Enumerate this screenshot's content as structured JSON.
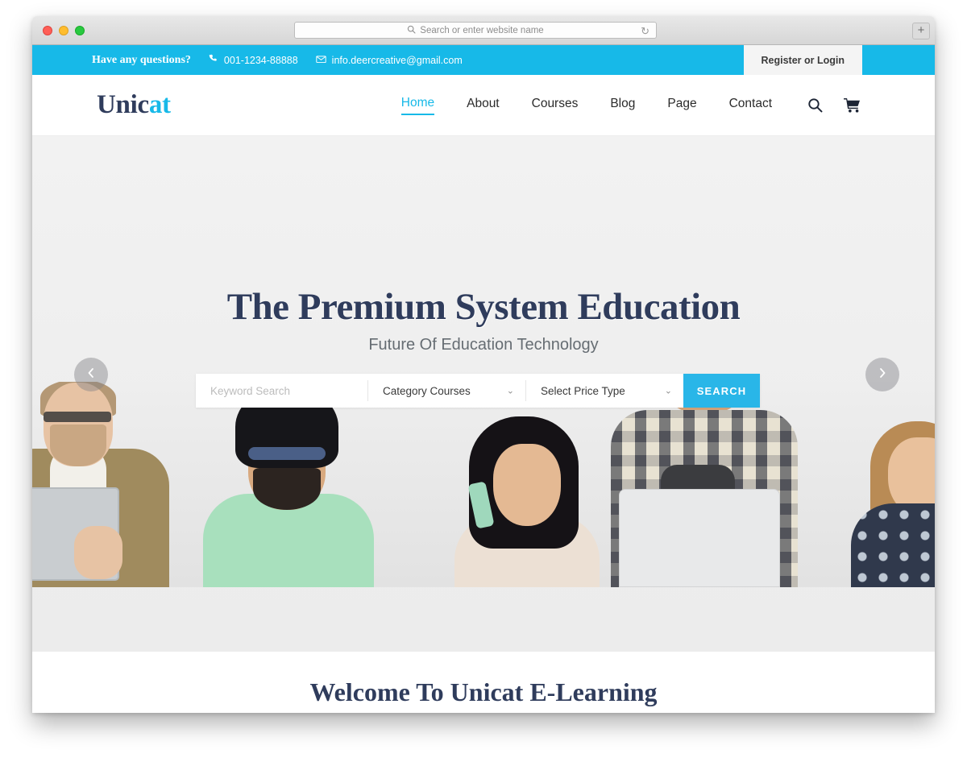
{
  "browser": {
    "url_placeholder": "Search or enter website name",
    "search_icon": "magnifier-icon",
    "reload_icon": "reload-icon",
    "new_tab_label": "+",
    "traffic_lights": [
      "close",
      "minimize",
      "maximize"
    ]
  },
  "topbar": {
    "questions_label": "Have any questions?",
    "phone_icon": "phone-icon",
    "phone": "001-1234-88888",
    "mail_icon": "envelope-icon",
    "email": "info.deercreative@gmail.com",
    "register_login": "Register or Login",
    "bg_color": "#17b9e8"
  },
  "nav": {
    "logo_main": "Unic",
    "logo_accent": "at",
    "links": [
      {
        "label": "Home",
        "active": true
      },
      {
        "label": "About",
        "active": false
      },
      {
        "label": "Courses",
        "active": false
      },
      {
        "label": "Blog",
        "active": false
      },
      {
        "label": "Page",
        "active": false
      },
      {
        "label": "Contact",
        "active": false
      }
    ],
    "search_icon": "search-icon",
    "cart_icon": "shopping-cart-icon",
    "accent_color": "#17b9e8",
    "text_color": "#2f3c5c"
  },
  "hero": {
    "title": "The Premium System Education",
    "subtitle": "Future Of Education Technology",
    "prev_icon": "chevron-left-icon",
    "next_icon": "chevron-right-icon"
  },
  "search_panel": {
    "keyword_placeholder": "Keyword Search",
    "keyword_value": "",
    "category_selected": "Category Courses",
    "price_selected": "Select Price Type",
    "chevron_icon": "chevron-down-icon",
    "button_label": "SEARCH",
    "button_color": "#29b6e8"
  },
  "welcome": {
    "title": "Welcome To Unicat E-Learning"
  }
}
